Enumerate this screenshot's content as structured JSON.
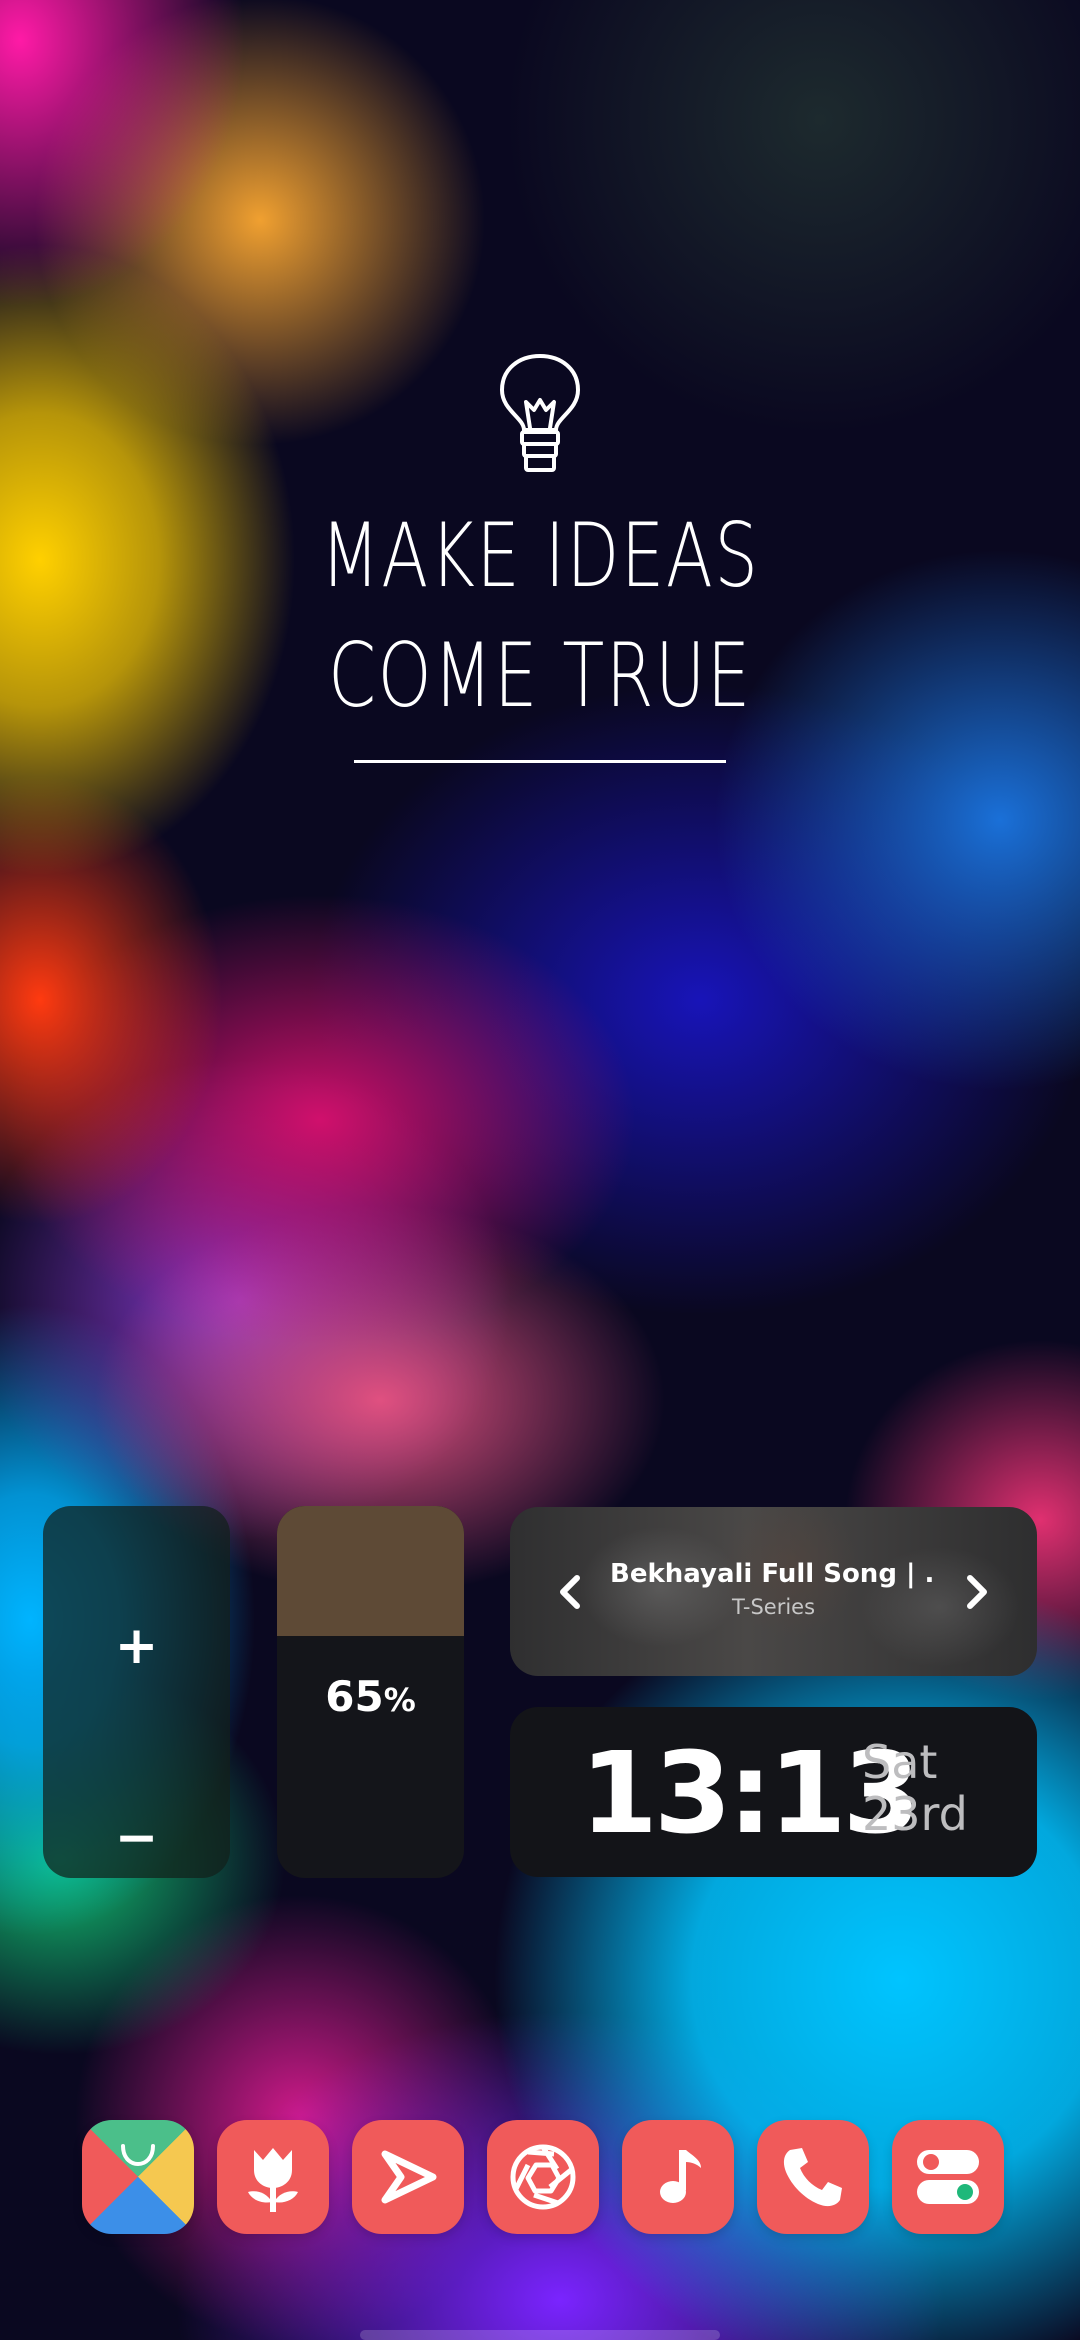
{
  "wallpaper": {
    "headline_line1": "MAKE IDEAS",
    "headline_line2": "COME TRUE",
    "icon": "lightbulb-icon"
  },
  "widgets": {
    "stepper": {
      "plus_label": "+",
      "minus_label": "−"
    },
    "level": {
      "value_number": "65",
      "value_unit": "%",
      "fill_fraction": 0.65
    },
    "music": {
      "title": "Bekhayali Full Song | ...",
      "artist": "T-Series",
      "prev_icon": "chevron-left-icon",
      "next_icon": "chevron-right-icon"
    },
    "clock": {
      "time": "13:13",
      "day": "Sat",
      "date": "23rd"
    }
  },
  "dock": {
    "apps": [
      {
        "icon": "shopping-bag-icon"
      },
      {
        "icon": "flower-icon"
      },
      {
        "icon": "play-icon"
      },
      {
        "icon": "camera-aperture-icon"
      },
      {
        "icon": "music-note-icon"
      },
      {
        "icon": "phone-icon"
      },
      {
        "icon": "toggle-settings-icon"
      }
    ]
  },
  "colors": {
    "dock_icon": "#f05a5a",
    "level_fill": "#5e4a36",
    "widget_dark": "#131418"
  }
}
